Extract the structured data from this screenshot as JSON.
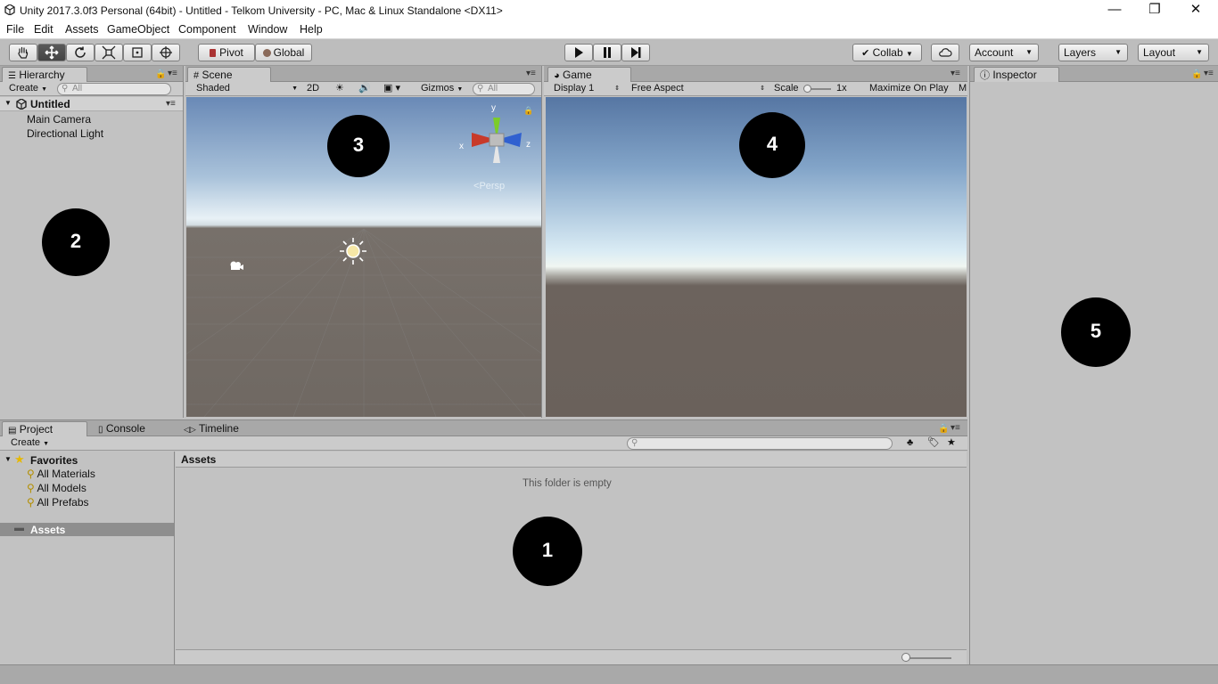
{
  "window": {
    "title": "Unity 2017.3.0f3 Personal (64bit) - Untitled - Telkom University - PC, Mac & Linux Standalone <DX11>",
    "minimize_glyph": "—",
    "restore_glyph": "❐",
    "close_glyph": "✕"
  },
  "menu": {
    "items": [
      "File",
      "Edit",
      "Assets",
      "GameObject",
      "Component",
      "Window",
      "Help"
    ]
  },
  "toolbar": {
    "pivot": "Pivot",
    "global": "Global",
    "collab": "Collab",
    "account": "Account",
    "layers": "Layers",
    "layout": "Layout"
  },
  "hierarchy": {
    "tab": "Hierarchy",
    "create": "Create",
    "search_placeholder": "All",
    "scene": "Untitled",
    "items": [
      "Main Camera",
      "Directional Light"
    ]
  },
  "scene": {
    "tab": "Scene",
    "shading": "Shaded",
    "mode_2d": "2D",
    "gizmos": "Gizmos",
    "search_placeholder": "All",
    "axis_x": "x",
    "axis_y": "y",
    "axis_z": "z",
    "persp": "Persp"
  },
  "game": {
    "tab": "Game",
    "display": "Display 1",
    "aspect": "Free Aspect",
    "scale_label": "Scale",
    "scale_value": "1x",
    "maximize": "Maximize On Play",
    "more": "M"
  },
  "inspector": {
    "tab": "Inspector"
  },
  "project": {
    "tabs": [
      "Project",
      "Console",
      "Timeline"
    ],
    "create": "Create",
    "favorites": "Favorites",
    "favorite_items": [
      "All Materials",
      "All Models",
      "All Prefabs"
    ],
    "assets_folder": "Assets",
    "breadcrumb": "Assets",
    "empty_message": "This folder is empty"
  },
  "markers": [
    "1",
    "2",
    "3",
    "4",
    "5"
  ],
  "colors": {
    "panel_bg": "#c2c2c2",
    "sky_top": "#5d7fa8",
    "horizon": "#e9f3f7",
    "ground": "#6b625b"
  }
}
